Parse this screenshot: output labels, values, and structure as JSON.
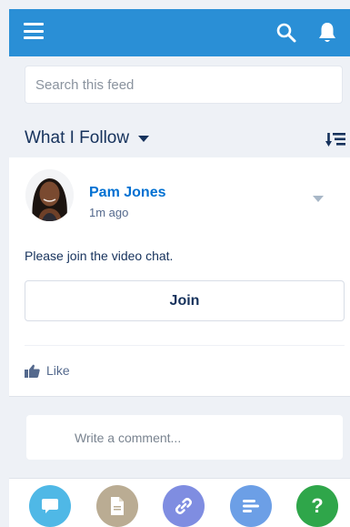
{
  "header": {
    "menu_icon": "hamburger-icon",
    "search_icon": "search-icon",
    "notifications_icon": "bell-icon",
    "background_color": "#2a8fd6"
  },
  "search": {
    "placeholder": "Search this feed",
    "value": ""
  },
  "feed_filter": {
    "label": "What I Follow",
    "caret_icon": "caret-down-icon",
    "sort_icon": "sort-icon"
  },
  "post": {
    "author": "Pam Jones",
    "timestamp": "1m ago",
    "body": "Please join the video chat.",
    "join_label": "Join",
    "menu_icon": "caret-down-icon",
    "like_label": "Like",
    "like_icon": "thumbs-up-icon",
    "author_color": "#0070d2"
  },
  "comment": {
    "placeholder": "Write a comment...",
    "value": ""
  },
  "actions": [
    {
      "icon": "post-icon",
      "color": "#4fb8e6"
    },
    {
      "icon": "file-icon",
      "color": "#baac93"
    },
    {
      "icon": "link-icon",
      "color": "#7f8de1"
    },
    {
      "icon": "poll-icon",
      "color": "#6c9fe6"
    },
    {
      "icon": "question-icon",
      "glyph": "?",
      "color": "#2fa64a"
    }
  ]
}
